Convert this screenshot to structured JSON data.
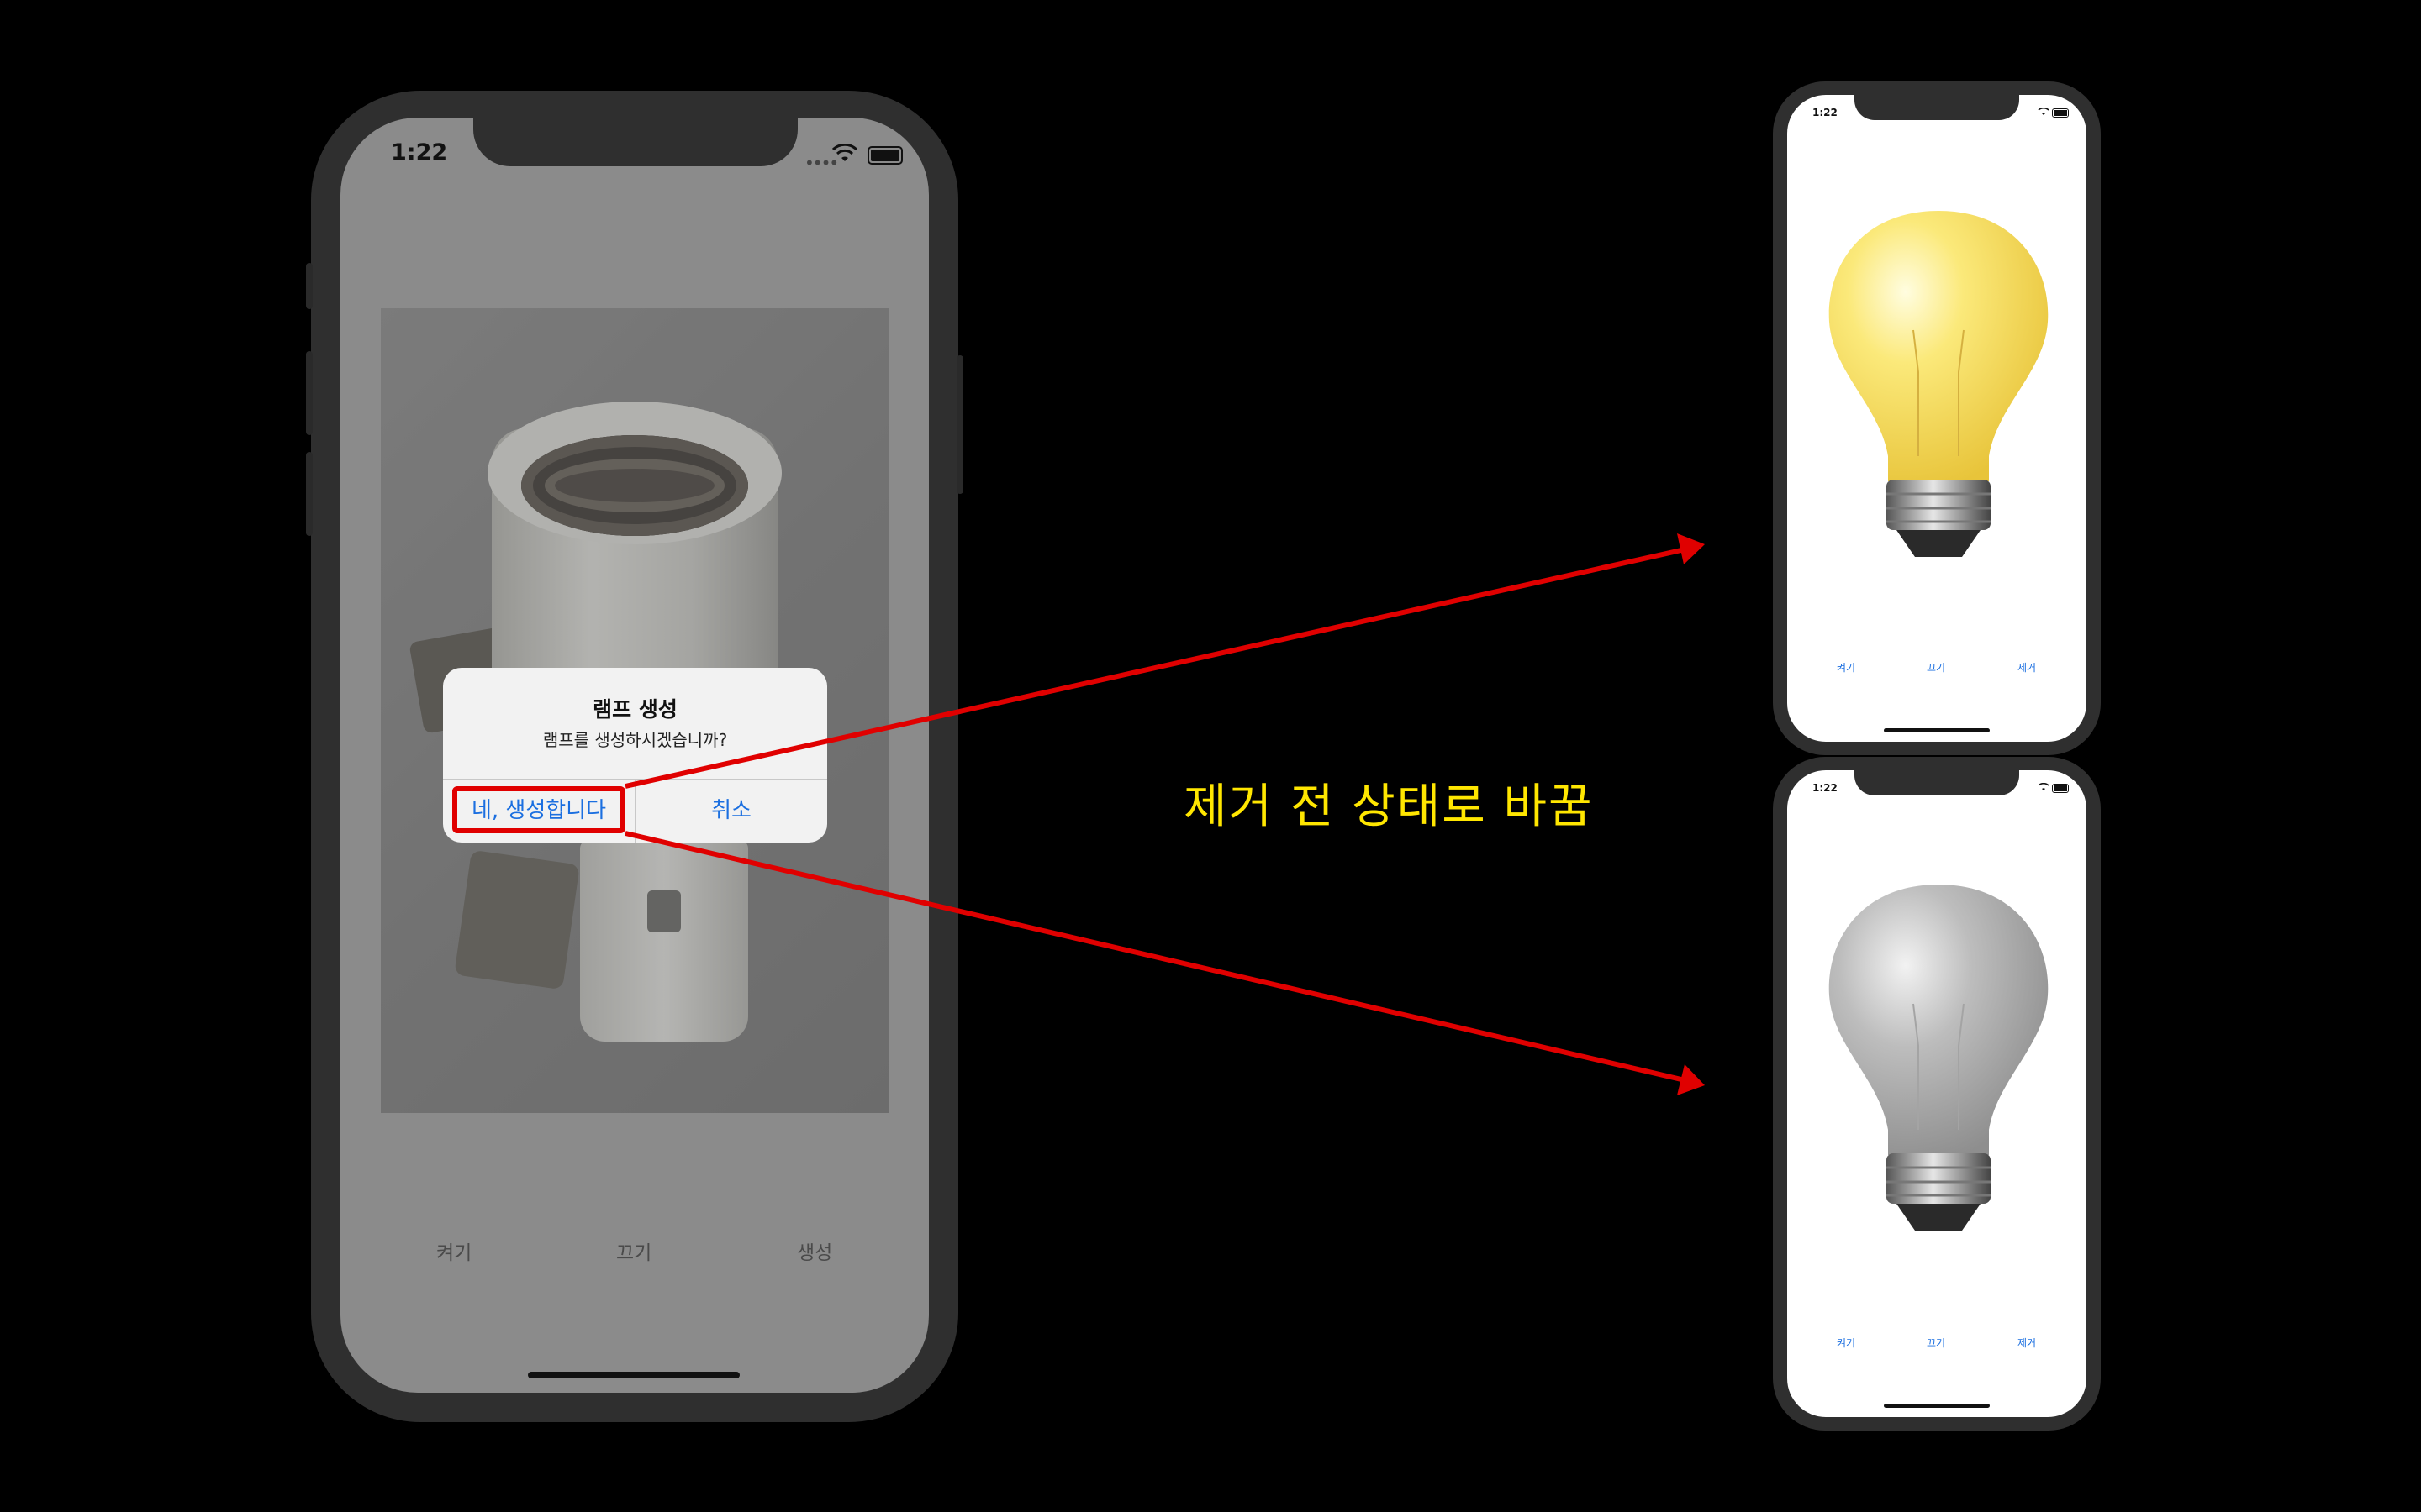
{
  "main_phone": {
    "status_time": "1:22",
    "alert": {
      "title": "램프 생성",
      "message": "램프를 생성하시겠습니까?",
      "confirm_label": "네, 생성합니다",
      "cancel_label": "취소"
    },
    "tabs": [
      "켜기",
      "끄기",
      "생성"
    ]
  },
  "caption": "제거 전 상태로 바꿈",
  "result_phone_on": {
    "status_time": "1:22",
    "bulb_state": "on",
    "tabs": [
      "켜기",
      "끄기",
      "제거"
    ]
  },
  "result_phone_off": {
    "status_time": "1:22",
    "bulb_state": "off",
    "tabs": [
      "켜기",
      "끄기",
      "제거"
    ]
  },
  "colors": {
    "arrow": "#e00000",
    "caption": "#ffe600",
    "link_blue": "#1b6fe0"
  }
}
